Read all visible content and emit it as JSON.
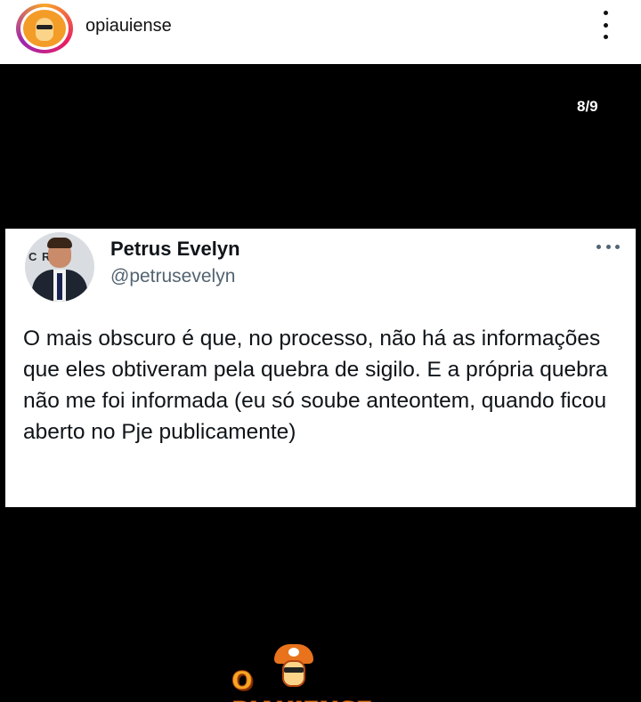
{
  "header": {
    "username": "opiauiense",
    "avatar_icon": "mascot-avatar-icon",
    "menu_icon": "more-vertical-icon"
  },
  "carousel": {
    "counter": "8/9"
  },
  "tweet": {
    "author_name": "Petrus Evelyn",
    "author_handle": "@petrusevelyn",
    "avatar_banner_text": "C RU",
    "text": "O mais obscuro é que, no processo, não há as informações que eles obtiveram pela quebra de sigilo. E a própria quebra não me foi informada (eu só soube anteontem, quando ficou aberto no Pje publicamente)",
    "more_icon": "more-horizontal-icon"
  },
  "brand": {
    "logo_text": "O PIAUIENSE"
  },
  "colors": {
    "background": "#000000",
    "header_bg": "#ffffff",
    "tweet_handle": "#536471",
    "brand_orange": "#f5a623"
  }
}
